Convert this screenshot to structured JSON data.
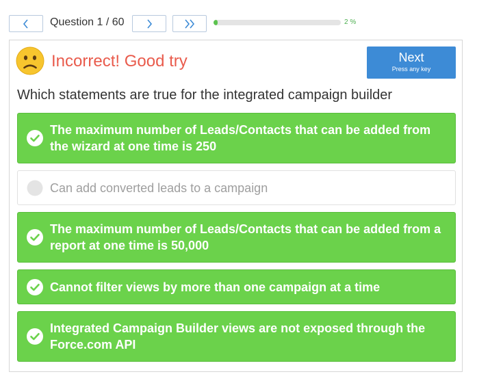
{
  "nav": {
    "question_counter": "Question 1 / 60",
    "progress_percent_label": "2 %",
    "progress_fraction": 0.02
  },
  "result": {
    "title": "Incorrect! Good try",
    "face_icon": "sad-face-icon",
    "next_label": "Next",
    "next_hint": "Press any key"
  },
  "question": {
    "text": "Which statements are true for the integrated campaign builder"
  },
  "answers": [
    {
      "text": "The maximum number of Leads/Contacts that can be added from the wizard at one time is 250",
      "state": "correct"
    },
    {
      "text": "Can add converted leads to a campaign",
      "state": "unselected"
    },
    {
      "text": "The maximum number of Leads/Contacts that can be added from a report at one time is 50,000",
      "state": "correct"
    },
    {
      "text": "Cannot filter views by more than one campaign at a time",
      "state": "correct"
    },
    {
      "text": "Integrated Campaign Builder views are not exposed through the Force.com API",
      "state": "correct"
    }
  ],
  "colors": {
    "correct": "#6bd24b",
    "incorrect_title": "#e95b4c",
    "primary_button": "#3d8bd6",
    "progress": "#5cc34e"
  }
}
